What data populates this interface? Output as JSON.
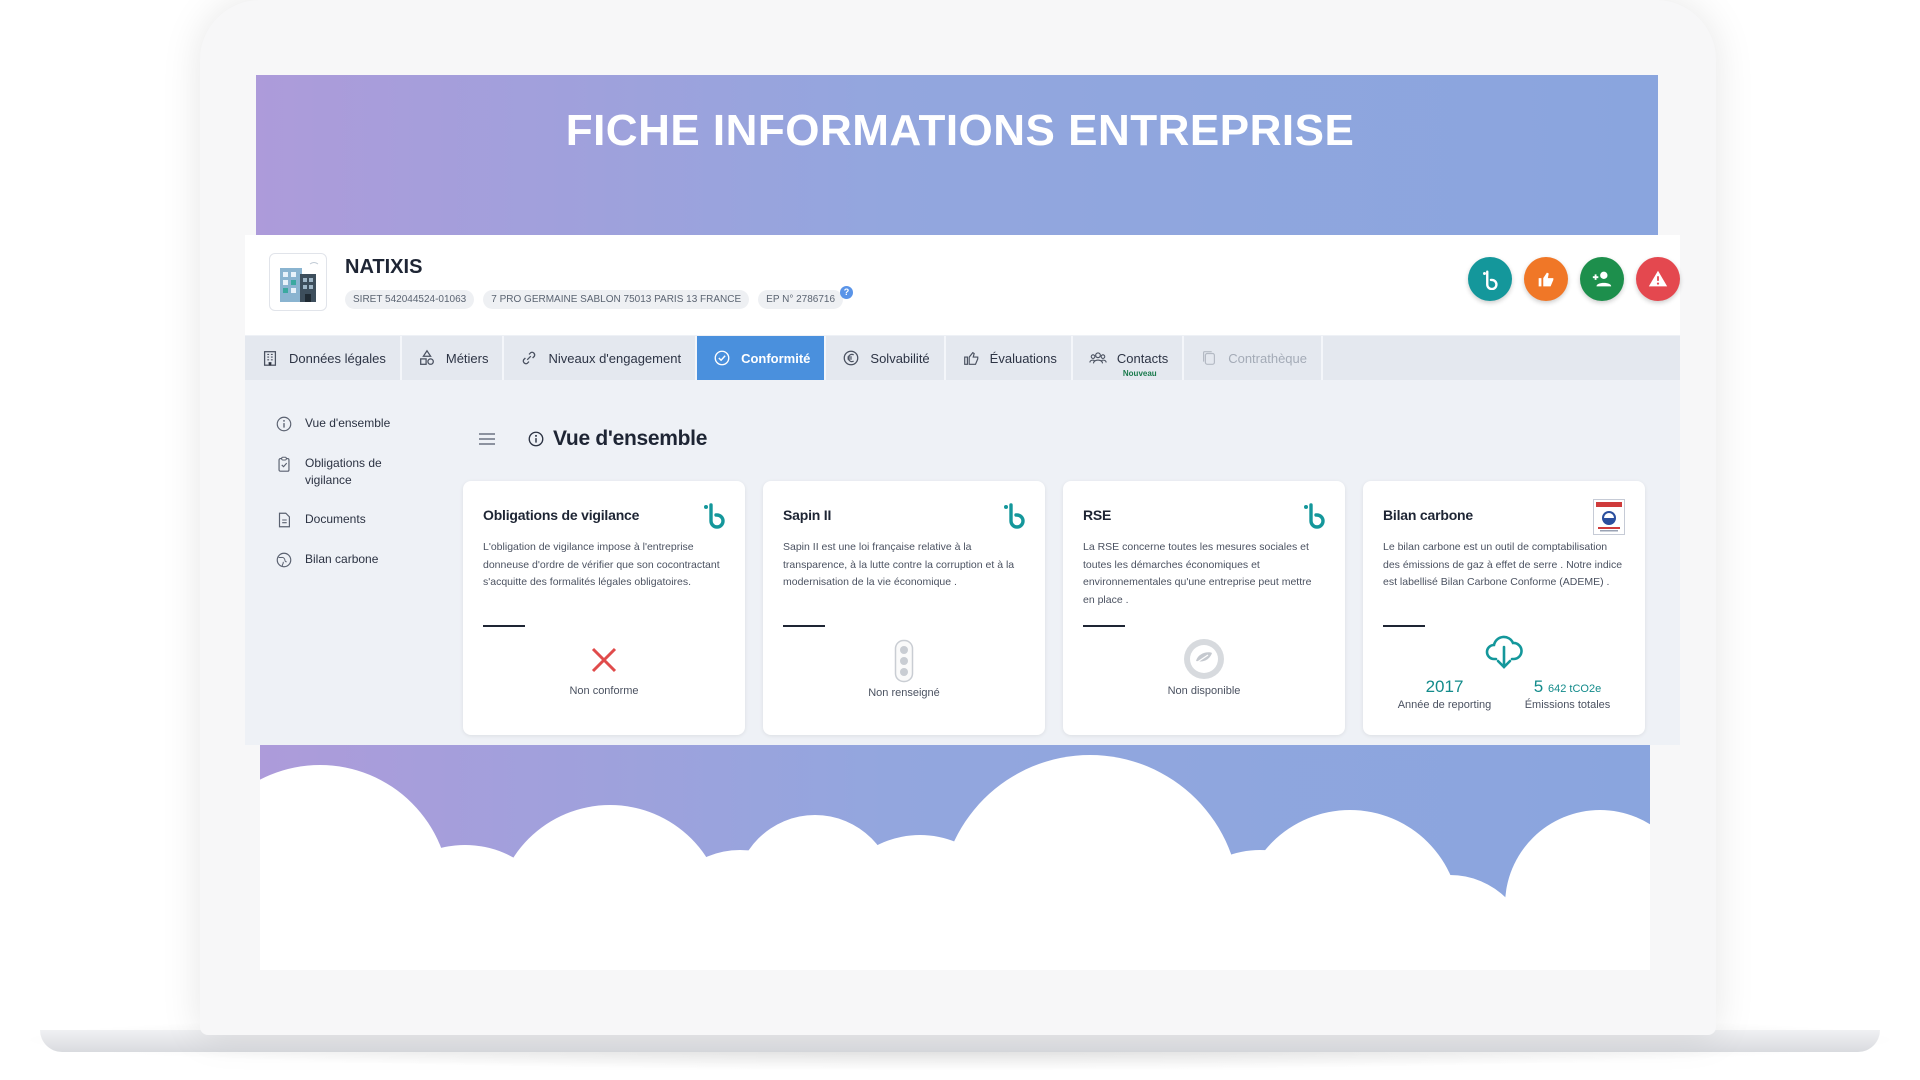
{
  "banner": {
    "title": "FICHE INFORMATIONS ENTREPRISE"
  },
  "company": {
    "name": "NATIXIS",
    "siret": "SIRET 542044524-01063",
    "address": "7 PRO GERMAINE SABLON 75013 PARIS 13 FRANCE",
    "ep": "EP N° 2786716"
  },
  "actions": [
    {
      "icon": "b-logo-icon",
      "color": "#14979b"
    },
    {
      "icon": "thumbs-up-icon",
      "color": "#f07727"
    },
    {
      "icon": "add-user-icon",
      "color": "#1d8f4c"
    },
    {
      "icon": "warning-icon",
      "color": "#e4484f"
    }
  ],
  "tabs": [
    {
      "label": "Données légales",
      "icon": "building-icon"
    },
    {
      "label": "Métiers",
      "icon": "shapes-icon"
    },
    {
      "label": "Niveaux d'engagement",
      "icon": "link-icon"
    },
    {
      "label": "Conformité",
      "icon": "check-circle-icon",
      "active": true
    },
    {
      "label": "Solvabilité",
      "icon": "euro-icon"
    },
    {
      "label": "Évaluations",
      "icon": "thumbs-up-icon"
    },
    {
      "label": "Contacts",
      "icon": "users-icon",
      "badge": "Nouveau"
    },
    {
      "label": "Contrathèque",
      "icon": "copy-icon",
      "disabled": true
    }
  ],
  "sidenav": [
    {
      "label": "Vue d'ensemble",
      "icon": "info-icon"
    },
    {
      "label": "Obligations de vigilance",
      "icon": "clipboard-icon"
    },
    {
      "label": "Documents",
      "icon": "document-icon"
    },
    {
      "label": "Bilan carbone",
      "icon": "globe-icon"
    }
  ],
  "section": {
    "title": "Vue d'ensemble"
  },
  "cards": [
    {
      "title": "Obligations de vigilance",
      "description": "L'obligation de vigilance impose à l'entreprise donneuse d'ordre de vérifier que son cocontractant s'acquitte des formalités légales obligatoires.",
      "status": "Non conforme",
      "status_icon": "cross-icon"
    },
    {
      "title": "Sapin II",
      "description": "Sapin II est une loi française relative à la transparence, à la lutte contre la corruption et à la modernisation de la vie économique .",
      "status": "Non renseigné",
      "status_icon": "traffic-light-icon"
    },
    {
      "title": "RSE",
      "description": "La RSE concerne toutes les mesures sociales et toutes les démarches économiques et environnementales qu'une entreprise peut mettre en place .",
      "status": "Non disponible",
      "status_icon": "leaf-badge-icon"
    },
    {
      "title": "Bilan carbone",
      "description": "Le bilan carbone est un outil de comptabilisation des émissions de gaz à effet de serre . Notre indice est labellisé Bilan Carbone Conforme (ADEME) .",
      "status_icon": "cloud-download-icon",
      "year": "2017",
      "year_label": "Année de reporting",
      "emissions": "5",
      "emissions_unit": "642 tCO2e",
      "emissions_label": "Émissions totales"
    }
  ],
  "colors": {
    "accent": "#4a90dd",
    "teal": "#14979b",
    "cross": "#e04b4b"
  }
}
